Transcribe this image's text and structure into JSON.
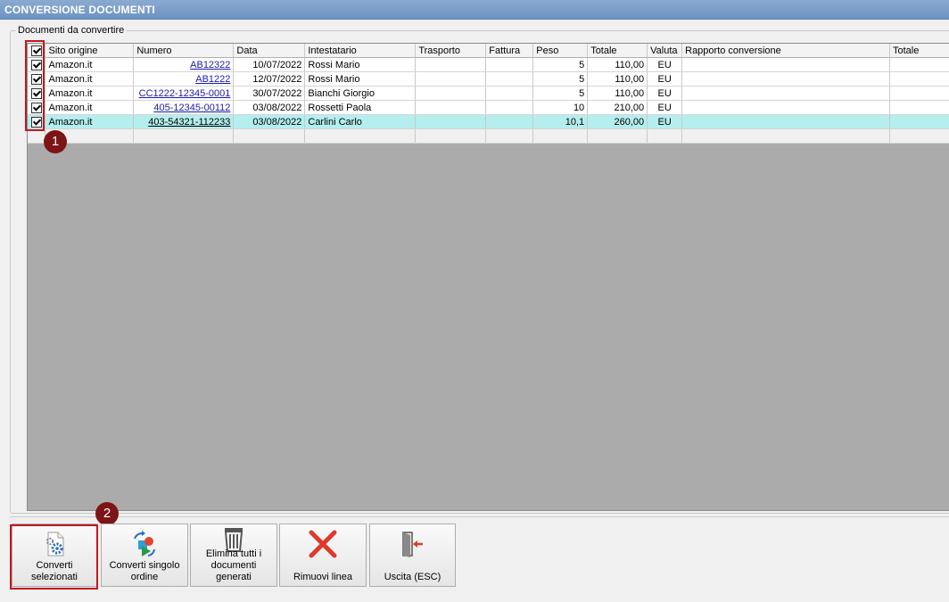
{
  "window": {
    "title": "CONVERSIONE DOCUMENTI"
  },
  "group": {
    "legend": "Documenti da convertire"
  },
  "table": {
    "columns": [
      "Sito origine",
      "Numero",
      "Data",
      "Intestatario",
      "Trasporto",
      "Fattura",
      "Peso",
      "Totale",
      "Valuta",
      "Rapporto conversione",
      "Totale"
    ],
    "rows": [
      {
        "sito": "Amazon.it",
        "numero": "AB12322",
        "data": "10/07/2022",
        "intestatario": "Rossi Mario",
        "trasporto": "",
        "fattura": "",
        "peso": "5",
        "totale": "110,00",
        "valuta": "EU",
        "rapporto": "",
        "totale2": ""
      },
      {
        "sito": "Amazon.it",
        "numero": "AB1222",
        "data": "12/07/2022",
        "intestatario": "Rossi Mario",
        "trasporto": "",
        "fattura": "",
        "peso": "5",
        "totale": "110,00",
        "valuta": "EU",
        "rapporto": "",
        "totale2": ""
      },
      {
        "sito": "Amazon.it",
        "numero": "CC1222-12345-0001",
        "data": "30/07/2022",
        "intestatario": "Bianchi Giorgio",
        "trasporto": "",
        "fattura": "",
        "peso": "5",
        "totale": "110,00",
        "valuta": "EU",
        "rapporto": "",
        "totale2": ""
      },
      {
        "sito": "Amazon.it",
        "numero": "405-12345-00112",
        "data": "03/08/2022",
        "intestatario": "Rossetti Paola",
        "trasporto": "",
        "fattura": "",
        "peso": "10",
        "totale": "210,00",
        "valuta": "EU",
        "rapporto": "",
        "totale2": ""
      },
      {
        "sito": "Amazon.it",
        "numero": "403-54321-112233",
        "data": "03/08/2022",
        "intestatario": "Carlini Carlo",
        "trasporto": "",
        "fattura": "",
        "peso": "10,1",
        "totale": "260,00",
        "valuta": "EU",
        "rapporto": "",
        "totale2": ""
      }
    ]
  },
  "annotations": {
    "badge1": "1",
    "badge2": "2",
    "color": "#7d1416",
    "outline_color": "#c0191f"
  },
  "buttons": {
    "converti_selezionati": "Converti selezionati",
    "converti_singolo": "Converti singolo ordine",
    "elimina_tutti": "Elimina tutti i documenti generati",
    "rimuovi_linea": "Rimuovi linea",
    "uscita": "Uscita (ESC)"
  },
  "icons": {
    "converti_selezionati": "document-gear-icon",
    "converti_singolo": "convert-shapes-icon",
    "elimina_tutti": "trash-bin-icon",
    "rimuovi_linea": "red-x-icon",
    "uscita": "exit-door-icon"
  }
}
